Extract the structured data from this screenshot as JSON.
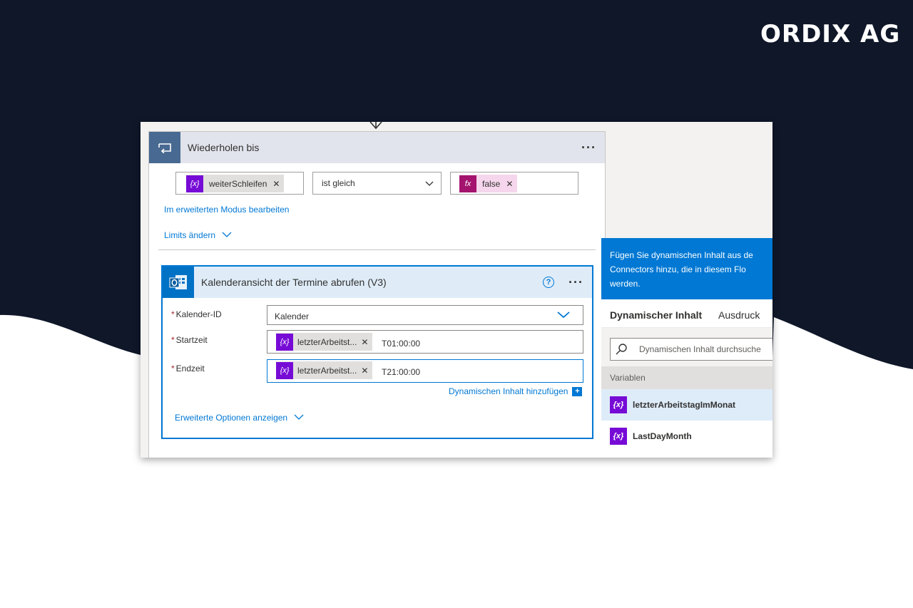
{
  "brand": {
    "logo": "ORDIX AG"
  },
  "colors": {
    "dark_bg": "#0f1729",
    "accent": "#0078d4",
    "variable": "#770bd6",
    "expression": "#a4136e"
  },
  "loop": {
    "title": "Wiederholen bis",
    "more": "···",
    "condition": {
      "left_token": "weiterSchleifen",
      "operator": "ist gleich",
      "right_token": "false",
      "var_glyph": "{x}",
      "fx_glyph": "fx"
    },
    "advanced_link": "Im erweiterten Modus bearbeiten",
    "limits_link": "Limits ändern"
  },
  "action": {
    "title": "Kalenderansicht der Termine abrufen (V3)",
    "help": "?",
    "more": "···",
    "fields": {
      "calendar_label": "Kalender-ID",
      "calendar_value": "Kalender",
      "start_label": "Startzeit",
      "start_token": "letzterArbeitst...",
      "start_suffix": "T01:00:00",
      "end_label": "Endzeit",
      "end_token": "letzterArbeitst...",
      "end_suffix": "T21:00:00"
    },
    "add_dynamic": "Dynamischen Inhalt hinzufügen",
    "advanced_options": "Erweiterte Optionen anzeigen"
  },
  "panel": {
    "info_line1": "Fügen Sie dynamischen Inhalt aus de",
    "info_line2": "Connectors hinzu, die in diesem Flo",
    "info_line3": "werden.",
    "tab_dynamic": "Dynamischer Inhalt",
    "tab_expression": "Ausdruck",
    "search_placeholder": "Dynamischen Inhalt durchsuche",
    "section": "Variablen",
    "items": [
      "letzterArbeitstagImMonat",
      "LastDayMonth"
    ]
  }
}
